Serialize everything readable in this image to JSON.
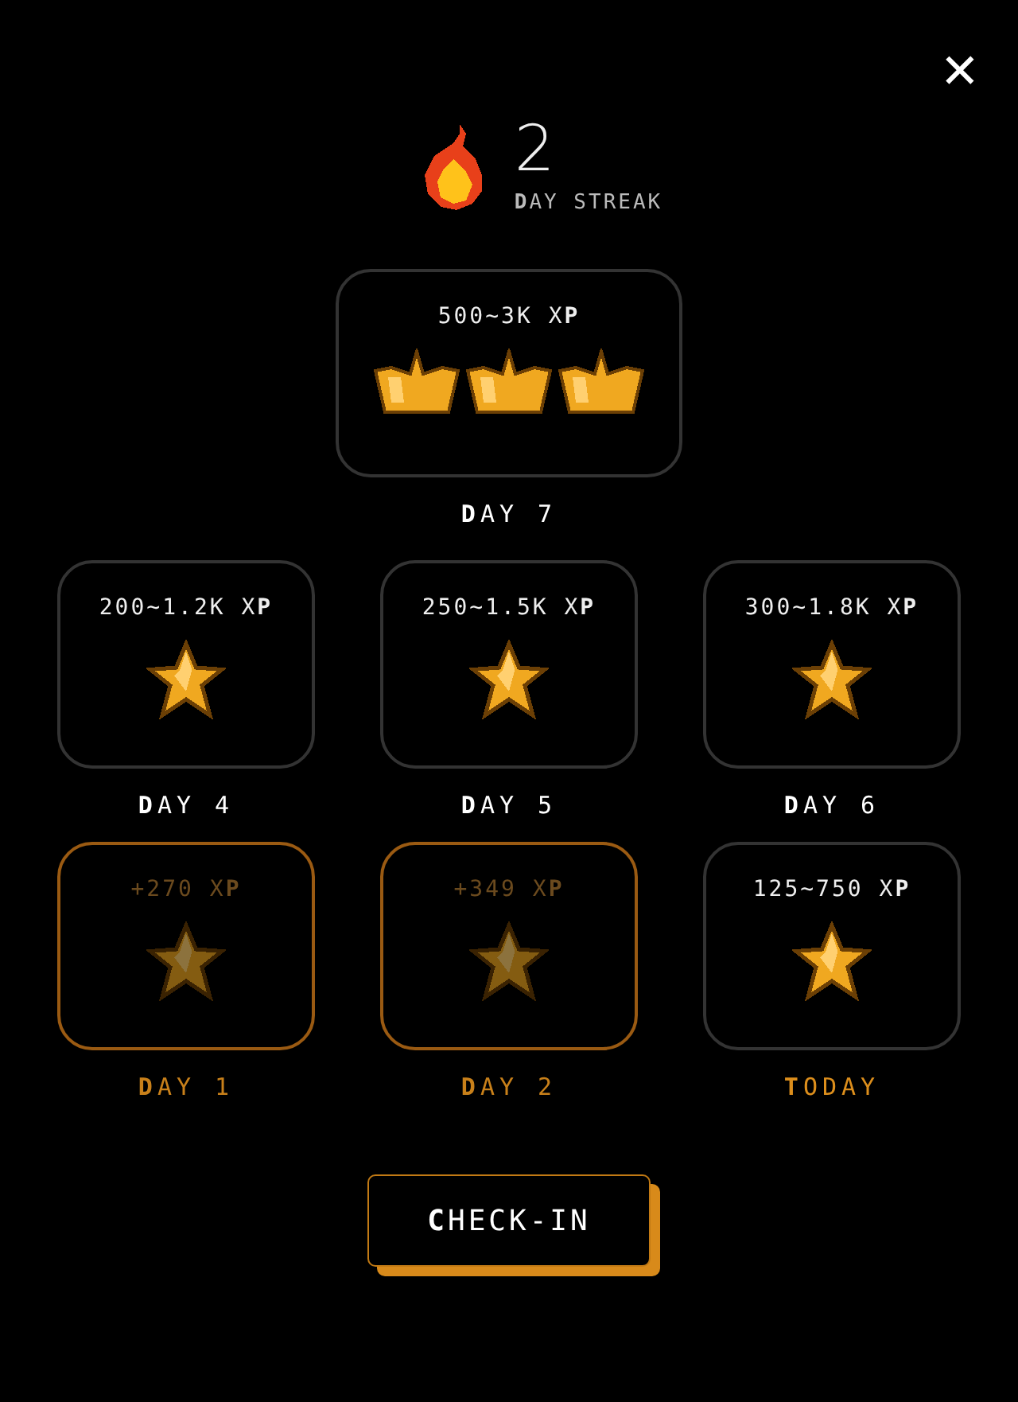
{
  "close": {
    "label": "✕"
  },
  "streak": {
    "count": "2",
    "label": "**D**AY STREAK"
  },
  "days": [
    {
      "kind": "crowns",
      "claimed": false,
      "today": false,
      "xp": "500~3K X**P**",
      "label": "**D**AY 7"
    },
    {
      "kind": "star",
      "claimed": false,
      "today": false,
      "xp": "200~1.2K X**P**",
      "label": "**D**AY 4"
    },
    {
      "kind": "star",
      "claimed": false,
      "today": false,
      "xp": "250~1.5K X**P**",
      "label": "**D**AY 5"
    },
    {
      "kind": "star",
      "claimed": false,
      "today": false,
      "xp": "300~1.8K X**P**",
      "label": "**D**AY 6"
    },
    {
      "kind": "star",
      "claimed": true,
      "today": false,
      "xp": "+270 X**P**",
      "label": "**D**AY 1"
    },
    {
      "kind": "star",
      "claimed": true,
      "today": false,
      "xp": "+349 X**P**",
      "label": "**D**AY 2"
    },
    {
      "kind": "star",
      "claimed": false,
      "today": true,
      "xp": "125~750 X**P**",
      "label": "**T**ODAY"
    }
  ],
  "button": {
    "label": "**C**HECK-IN"
  }
}
